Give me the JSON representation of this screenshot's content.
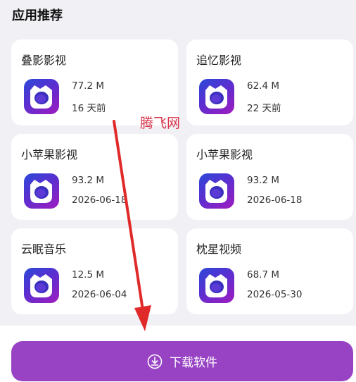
{
  "section": {
    "title": "应用推荐"
  },
  "apps": [
    {
      "name": "叠影影视",
      "size": "77.2 M",
      "date": "16 天前"
    },
    {
      "name": "追忆影视",
      "size": "62.4 M",
      "date": "22 天前"
    },
    {
      "name": "小苹果影视",
      "size": "93.2 M",
      "date": "2026-06-18"
    },
    {
      "name": "小苹果影视",
      "size": "93.2 M",
      "date": "2026-06-18"
    },
    {
      "name": "云眠音乐",
      "size": "12.5 M",
      "date": "2026-06-04"
    },
    {
      "name": "枕星视频",
      "size": "68.7 M",
      "date": "2026-05-30"
    }
  ],
  "watermark": {
    "text": "腾飞网"
  },
  "download": {
    "label": "下载软件",
    "icon": "download-icon"
  },
  "colors": {
    "accent": "#9843c4",
    "annotation_arrow": "#e02a2a",
    "watermark": "#d9344a"
  }
}
